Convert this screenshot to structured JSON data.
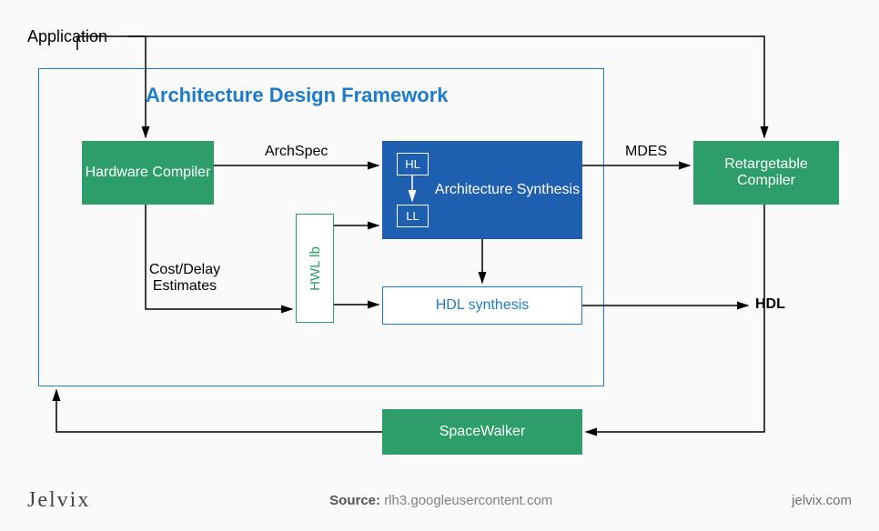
{
  "diagram": {
    "application_label": "Application",
    "framework_title": "Architecture Design Framework",
    "hardware_compiler": "Hardware Compiler",
    "arch_synthesis": "Architecture Synthesis",
    "hl": "HL",
    "ll": "LL",
    "retargetable_compiler": "Retargetable Compiler",
    "hwl_lb": "HWL lb",
    "hdl_synthesis": "HDL synthesis",
    "spacewalker": "SpaceWalker",
    "edges": {
      "archspec": "ArchSpec",
      "mdes": "MDES",
      "hdl": "HDL",
      "cost_delay": "Cost/Delay Estimates"
    }
  },
  "footer": {
    "logo": "Jelvix",
    "source_label": "Source:",
    "source_value": "rlh3.googleusercontent.com",
    "url": "jelvix.com"
  }
}
